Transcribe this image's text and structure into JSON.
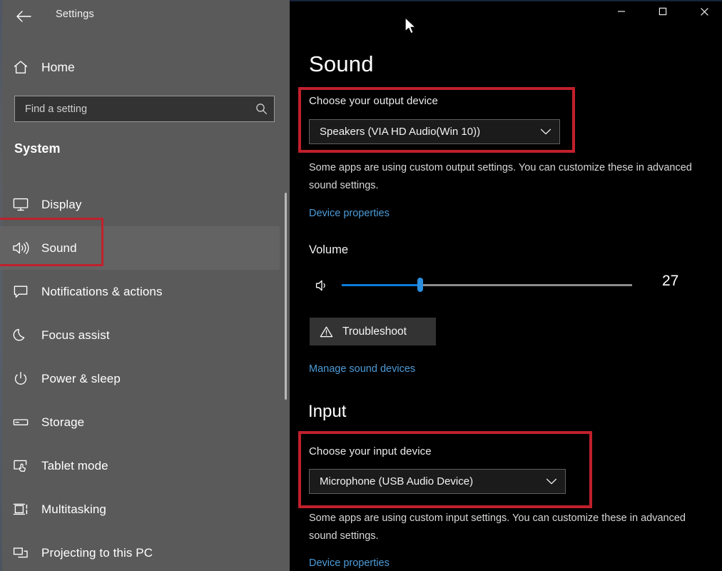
{
  "window": {
    "app_title": "Settings",
    "back_icon": "back-arrow-icon",
    "caption": {
      "minimize_label": "—",
      "maximize_label": "□",
      "close_label": "✕"
    }
  },
  "sidebar": {
    "home_label": "Home",
    "home_icon": "home-icon",
    "search": {
      "placeholder": "Find a setting",
      "value": "",
      "icon": "search-icon"
    },
    "group_heading": "System",
    "items": [
      {
        "label": "Display",
        "icon": "monitor-icon",
        "selected": false
      },
      {
        "label": "Sound",
        "icon": "speaker-icon",
        "selected": true
      },
      {
        "label": "Notifications & actions",
        "icon": "chat-bubble-icon",
        "selected": false
      },
      {
        "label": "Focus assist",
        "icon": "moon-icon",
        "selected": false
      },
      {
        "label": "Power & sleep",
        "icon": "power-icon",
        "selected": false
      },
      {
        "label": "Storage",
        "icon": "drive-icon",
        "selected": false
      },
      {
        "label": "Tablet mode",
        "icon": "tablet-touch-icon",
        "selected": false
      },
      {
        "label": "Multitasking",
        "icon": "multitasking-icon",
        "selected": false
      },
      {
        "label": "Projecting to this PC",
        "icon": "project-screen-icon",
        "selected": false
      }
    ]
  },
  "main": {
    "page_title": "Sound",
    "output": {
      "label": "Choose your output device",
      "selected_device": "Speakers (VIA HD Audio(Win 10))",
      "dropdown_icon": "chevron-down-icon",
      "description": "Some apps are using custom output settings. You can customize these in advanced sound settings.",
      "device_properties_link": "Device properties"
    },
    "volume": {
      "label": "Volume",
      "value": "27",
      "level_percent": 27,
      "speaker_icon": "speaker-low-icon"
    },
    "troubleshoot": {
      "label": "Troubleshoot",
      "icon": "warning-triangle-icon"
    },
    "manage_sound_devices_link": "Manage sound devices",
    "input": {
      "heading": "Input",
      "label": "Choose your input device",
      "selected_device": "Microphone (USB Audio Device)",
      "dropdown_icon": "chevron-down-icon",
      "description": "Some apps are using custom input settings. You can customize these in advanced sound settings.",
      "device_properties_link": "Device properties"
    }
  },
  "annotations": {
    "highlight_color": "#c0202c",
    "boxes": [
      "output-device-box",
      "input-device-box",
      "sound-nav-box"
    ]
  },
  "theme": {
    "sidebar_bg": "#5a5a5a",
    "content_bg": "#000000",
    "accent_blue": "#0a7ddb",
    "link_blue": "#4c9bd8"
  }
}
